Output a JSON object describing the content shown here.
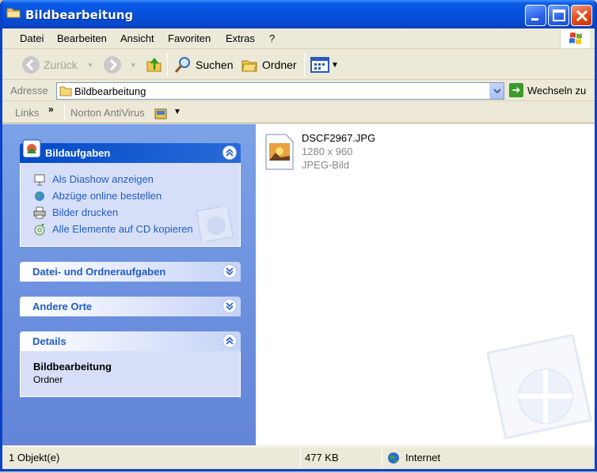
{
  "window": {
    "title": "Bildbearbeitung"
  },
  "menu": [
    "Datei",
    "Bearbeiten",
    "Ansicht",
    "Favoriten",
    "Extras",
    "?"
  ],
  "toolbar": {
    "back": "Zurück",
    "search": "Suchen",
    "folders": "Ordner"
  },
  "address": {
    "label": "Adresse",
    "value": "Bildbearbeitung",
    "go": "Wechseln zu"
  },
  "links": {
    "label": "Links",
    "chevron": "»",
    "norton": "Norton AntiVirus"
  },
  "taskpane": {
    "image_tasks": {
      "title": "Bildaufgaben",
      "items": [
        "Als Diashow anzeigen",
        "Abzüge online bestellen",
        "Bilder drucken",
        "Alle Elemente auf CD kopieren"
      ]
    },
    "file_tasks": {
      "title": "Datei- und Ordneraufgaben"
    },
    "other_places": {
      "title": "Andere Orte"
    },
    "details": {
      "title": "Details",
      "name": "Bildbearbeitung",
      "type": "Ordner"
    }
  },
  "files": [
    {
      "name": "DSCF2967.JPG",
      "dimensions": "1280 x 960",
      "type": "JPEG-Bild"
    }
  ],
  "status": {
    "objects": "1 Objekt(e)",
    "size": "477 KB",
    "zone": "Internet"
  },
  "colors": {
    "titlebar": "#0551dd",
    "taskpane": "#6b8fde",
    "link": "#215dc6"
  }
}
